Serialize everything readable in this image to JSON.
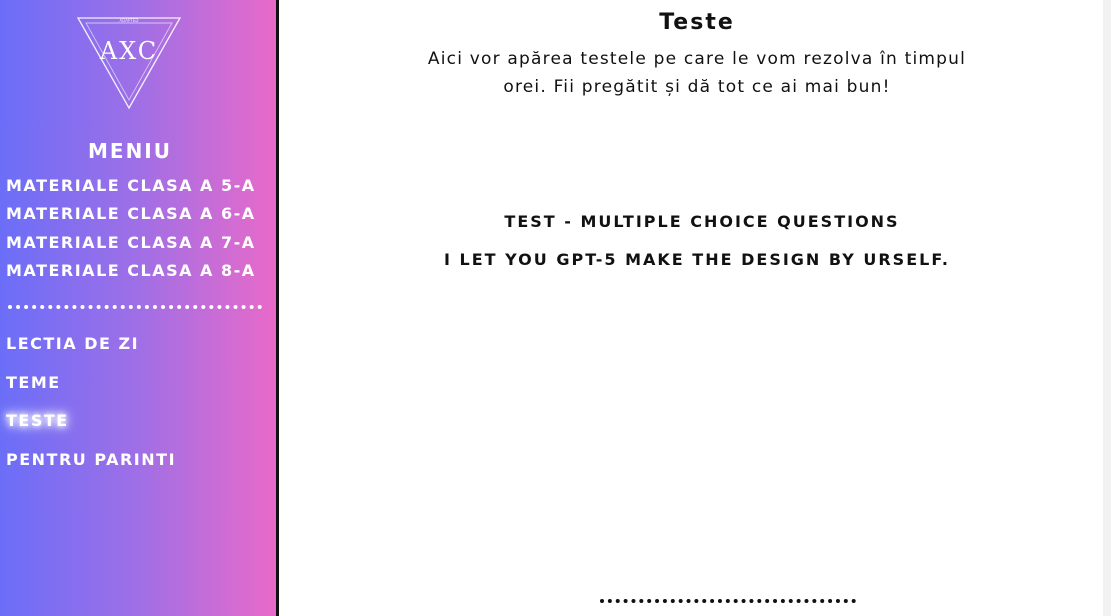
{
  "sidebar": {
    "logo": {
      "letters": "AXC",
      "small_text": "ADAPTED"
    },
    "menu_title": "MENIU",
    "class_items": [
      {
        "label": "MATERIALE CLASA A 5-A"
      },
      {
        "label": "MATERIALE CLASA A 6-A"
      },
      {
        "label": "MATERIALE CLASA A 7-A"
      },
      {
        "label": "MATERIALE CLASA A 8-A"
      }
    ],
    "nav_items": [
      {
        "label": "LECTIA DE ZI"
      },
      {
        "label": "TEME"
      },
      {
        "label": "TESTE",
        "active": true
      },
      {
        "label": "PENTRU PARINTI"
      }
    ]
  },
  "main": {
    "title": "Teste",
    "description": "Aici vor apărea testele pe care le vom rezolva în timpul orei. Fii pregătit și dă tot ce ai mai bun!",
    "test_heading": "TEST - MULTIPLE CHOICE QUESTIONS",
    "test_note": "I LET YOU GPT-5 MAKE THE DESIGN BY URSELF."
  },
  "colors": {
    "sidebar_gradient_start": "#6b6ef8",
    "sidebar_gradient_end": "#e96ac9",
    "sidebar_border": "#111111",
    "text_main": "#111111",
    "text_sidebar": "#ffffff"
  }
}
